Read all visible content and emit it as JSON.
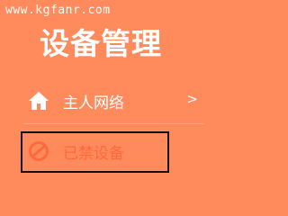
{
  "watermark": "www.kgfanr.com",
  "page_title": "设备管理",
  "menu": {
    "items": [
      {
        "label": "主人网络",
        "icon": "home-icon",
        "chevron": ">"
      },
      {
        "label": "已禁设备",
        "icon": "blocked-icon"
      }
    ]
  },
  "colors": {
    "background": "#FF8A5C",
    "text": "#FFFFFF",
    "dim_text": "#FF6A3D",
    "highlight_border": "#111111"
  }
}
